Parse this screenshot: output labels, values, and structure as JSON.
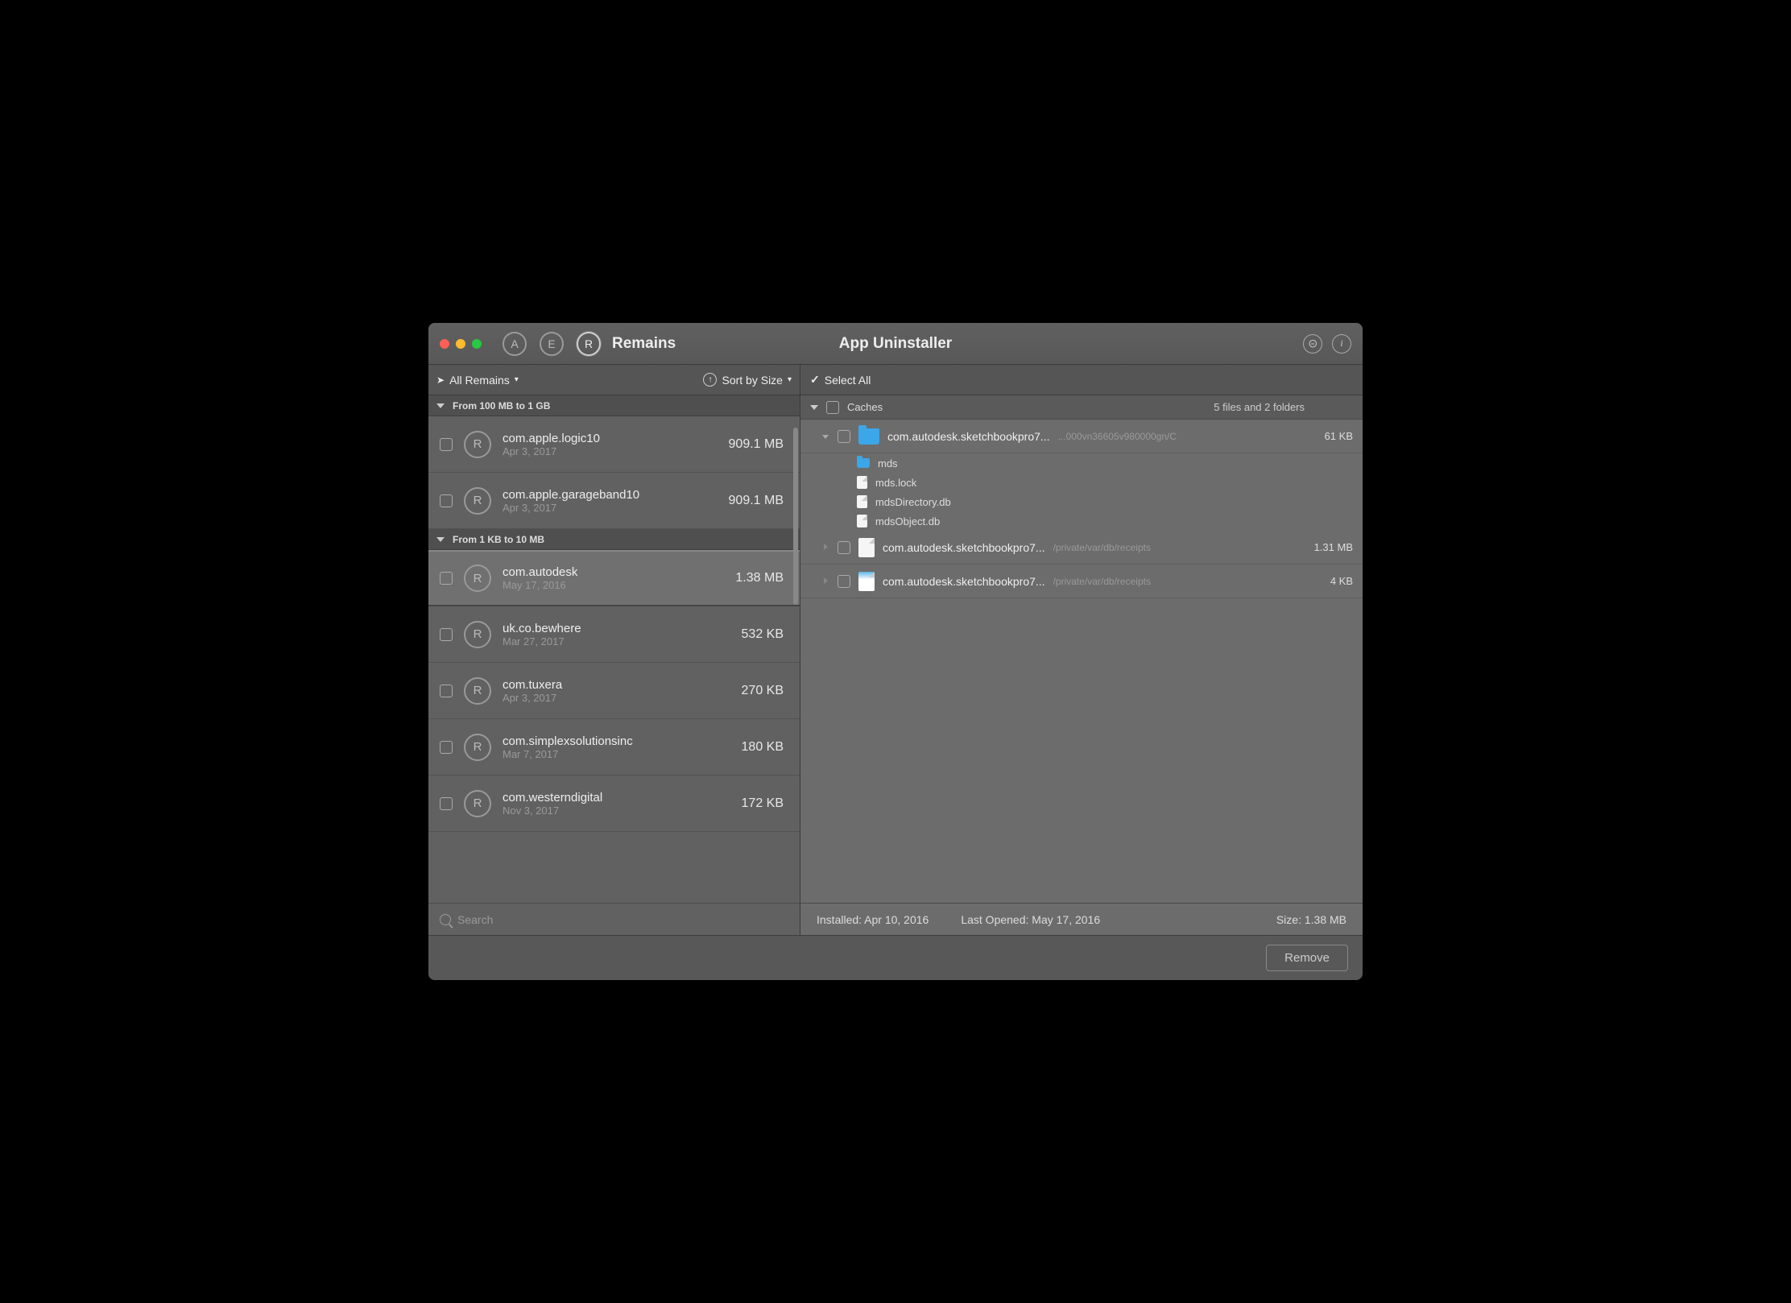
{
  "titlebar": {
    "icons": {
      "a": "A",
      "e": "E",
      "r": "R"
    },
    "section": "Remains",
    "app": "App Uninstaller",
    "help": "?",
    "info": "i"
  },
  "toolbar": {
    "filter": "All Remains",
    "sort": "Sort by Size",
    "selectAll": "Select All"
  },
  "groups": [
    {
      "label": "From 100 MB to 1 GB",
      "items": [
        {
          "name": "com.apple.logic10",
          "date": "Apr 3, 2017",
          "size": "909.1 MB",
          "selected": false
        },
        {
          "name": "com.apple.garageband10",
          "date": "Apr 3, 2017",
          "size": "909.1 MB",
          "selected": false
        }
      ]
    },
    {
      "label": "From 1 KB to 10 MB",
      "items": [
        {
          "name": "com.autodesk",
          "date": "May 17, 2016",
          "size": "1.38 MB",
          "selected": true
        },
        {
          "name": "uk.co.bewhere",
          "date": "Mar 27, 2017",
          "size": "532 KB",
          "selected": false
        },
        {
          "name": "com.tuxera",
          "date": "Apr 3, 2017",
          "size": "270 KB",
          "selected": false
        },
        {
          "name": "com.simplexsolutionsinc",
          "date": "Mar 7, 2017",
          "size": "180 KB",
          "selected": false
        },
        {
          "name": "com.westerndigital",
          "date": "Nov 3, 2017",
          "size": "172 KB",
          "selected": false
        }
      ]
    }
  ],
  "detail": {
    "category": "Caches",
    "count": "5 files and 2 folders",
    "expanded": {
      "name": "com.autodesk.sketchbookpro7...",
      "path": "...000vn36605v980000gn/C",
      "size": "61 KB",
      "children": [
        {
          "type": "folder",
          "name": "mds"
        },
        {
          "type": "file",
          "name": "mds.lock"
        },
        {
          "type": "file",
          "name": "mdsDirectory.db"
        },
        {
          "type": "file",
          "name": "mdsObject.db"
        }
      ]
    },
    "files": [
      {
        "icon": "file",
        "name": "com.autodesk.sketchbookpro7...",
        "path": "/private/var/db/receipts",
        "size": "1.31 MB"
      },
      {
        "icon": "plist",
        "name": "com.autodesk.sketchbookpro7...",
        "path": "/private/var/db/receipts",
        "size": "4 KB"
      }
    ]
  },
  "search": {
    "placeholder": "Search"
  },
  "status": {
    "installed": "Installed: Apr 10, 2016",
    "opened": "Last Opened: May 17, 2016",
    "size": "Size: 1.38 MB"
  },
  "buttons": {
    "remove": "Remove"
  }
}
